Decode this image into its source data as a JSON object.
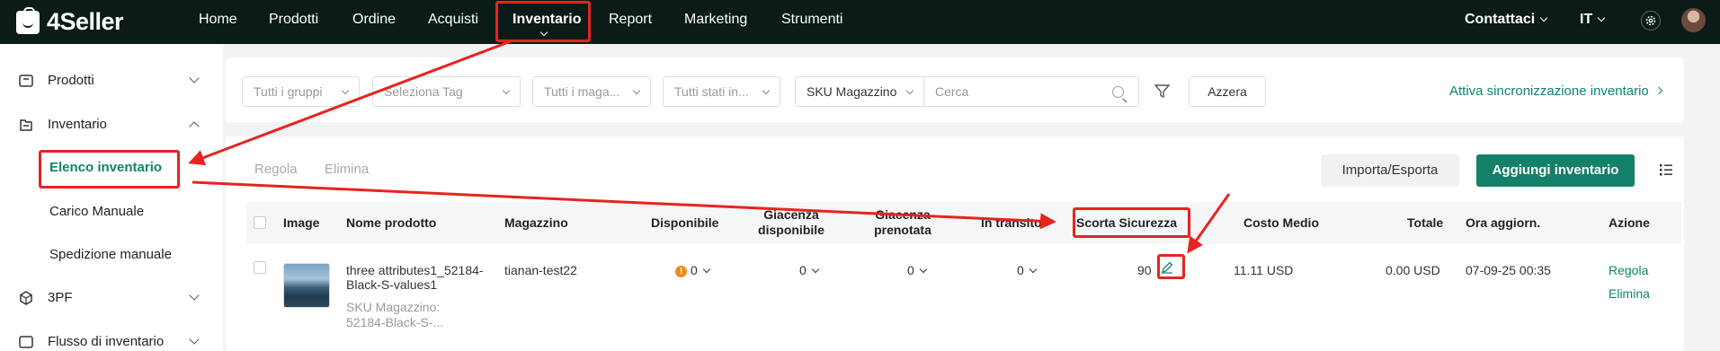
{
  "brand": {
    "name": "4Seller"
  },
  "topnav": {
    "items": [
      "Home",
      "Prodotti",
      "Ordine",
      "Acquisti",
      "Inventario",
      "Report",
      "Marketing",
      "Strumenti"
    ],
    "active": "Inventario",
    "contact_label": "Contattaci",
    "language": "IT"
  },
  "sidebar": {
    "items": [
      {
        "label": "Prodotti",
        "icon": "box-icon"
      },
      {
        "label": "Inventario",
        "icon": "inventory-icon"
      },
      {
        "label": "3PF",
        "icon": "3pf-icon"
      },
      {
        "label": "Flusso di inventario",
        "icon": "flow-icon"
      }
    ],
    "subitems": [
      "Elenco inventario",
      "Carico Manuale",
      "Spedizione manuale"
    ],
    "active_subitem": "Elenco inventario"
  },
  "filters": {
    "groups_placeholder": "Tutti i gruppi",
    "tag_placeholder": "Seleziona Tag",
    "warehouse_placeholder": "Tutti i maga...",
    "status_placeholder": "Tutti stati in...",
    "sku_select": "SKU Magazzino",
    "search_placeholder": "Cerca",
    "reset_label": "Azzera",
    "sync_link": "Attiva sincronizzazione inventario"
  },
  "toolbar": {
    "adjust_tab": "Regola",
    "delete_tab": "Elimina",
    "import_export": "Importa/Esporta",
    "add_inventory": "Aggiungi inventario"
  },
  "table": {
    "columns": {
      "image": "Image",
      "product": "Nome prodotto",
      "warehouse": "Magazzino",
      "available": "Disponibile",
      "stock_avail_1": "Giacenza",
      "stock_avail_2": "disponibile",
      "stock_res_1": "Giacenza",
      "stock_res_2": "prenotata",
      "in_transit": "In transito",
      "safety": "Scorta Sicurezza",
      "avg_cost": "Costo Medio",
      "total": "Totale",
      "updated": "Ora aggiorn.",
      "action": "Azione"
    },
    "rows": [
      {
        "product_name_1": "three attributes1_52184-",
        "product_name_2": "Black-S-values1",
        "sku_label": "SKU Magazzino:",
        "sku_value": "52184-Black-S-...",
        "warehouse": "tianan-test22",
        "available": "0",
        "stock_available": "0",
        "stock_reserved": "0",
        "in_transit": "0",
        "safety_stock": "90",
        "avg_cost": "11.11 USD",
        "total": "0.00 USD",
        "updated": "07-09-25 00:35",
        "action_adjust": "Regola",
        "action_delete": "Elimina"
      }
    ]
  },
  "colors": {
    "accent": "#10846b",
    "topbar": "#0b1b17",
    "annotation": "#e8231f",
    "warning": "#f08a1c"
  }
}
